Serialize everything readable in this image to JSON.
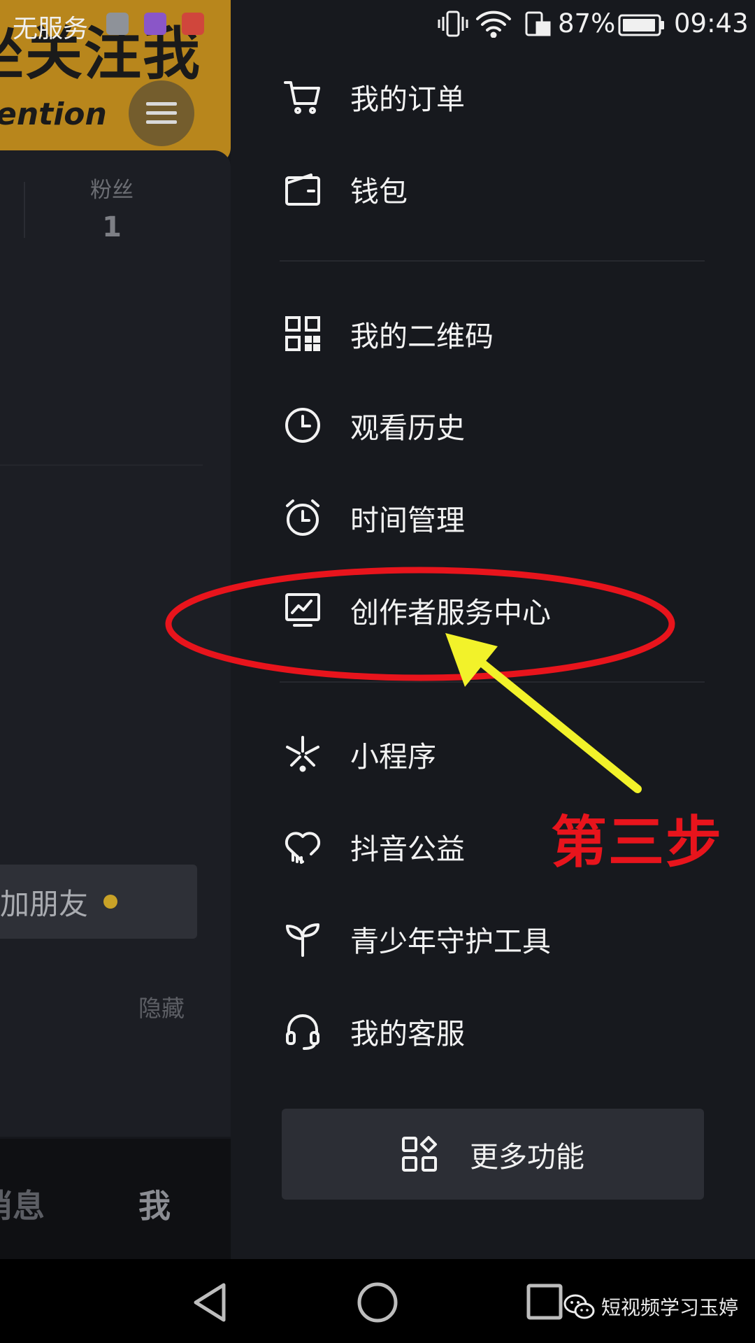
{
  "status_bar": {
    "carrier": "无服务",
    "battery": "87%",
    "time": "09:43"
  },
  "left_page": {
    "banner_text_line1": "坐关注我",
    "banner_text_line2": "ention",
    "fans_label": "粉丝",
    "fans_count": "1",
    "add_friend_label": "加朋友",
    "hide_label": "隐藏",
    "tab_messages": "消息",
    "tab_me": "我"
  },
  "drawer": {
    "items": [
      {
        "label": "我的订单",
        "icon": "cart-icon"
      },
      {
        "label": "钱包",
        "icon": "wallet-icon"
      },
      {
        "label": "我的二维码",
        "icon": "qr-code-icon"
      },
      {
        "label": "观看历史",
        "icon": "clock-icon"
      },
      {
        "label": "时间管理",
        "icon": "alarm-clock-icon"
      },
      {
        "label": "创作者服务中心",
        "icon": "chart-monitor-icon"
      },
      {
        "label": "小程序",
        "icon": "mini-program-icon"
      },
      {
        "label": "抖音公益",
        "icon": "heart-hands-icon"
      },
      {
        "label": "青少年守护工具",
        "icon": "sprout-icon"
      },
      {
        "label": "我的客服",
        "icon": "headset-icon"
      }
    ],
    "more_label": "更多功能"
  },
  "annotation": {
    "step_text": "第三步",
    "circle_color": "#e8141c",
    "arrow_color": "#f2f22a"
  },
  "watermark": {
    "text": "短视频学习玉婷"
  }
}
